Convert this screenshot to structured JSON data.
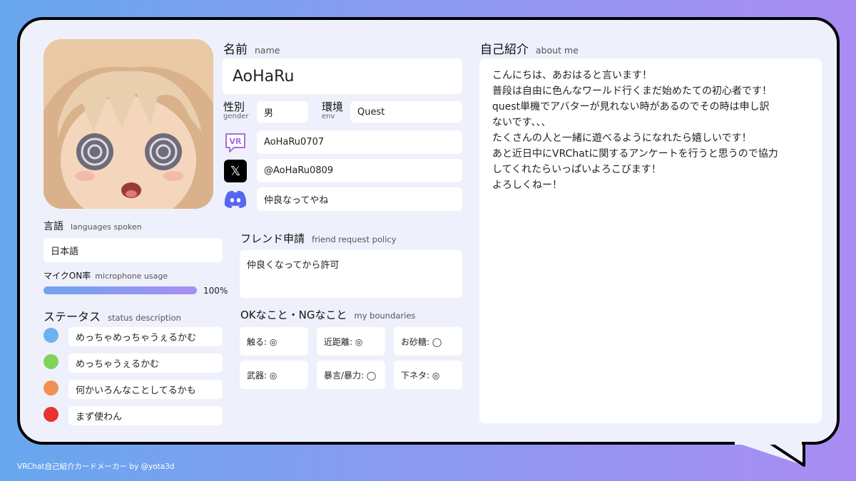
{
  "profile": {
    "name_label": "名前",
    "name_sub": "name",
    "name": "AoHaRu",
    "gender_label": "性別",
    "gender_sub": "gender",
    "gender": "男",
    "env_label": "環境",
    "env_sub": "env",
    "env": "Quest",
    "vrchat_id": "AoHaRu0707",
    "x_handle": "@AoHaRu0809",
    "discord_note": "仲良なってやね"
  },
  "icons": {
    "vrchat": "vrchat-logo-icon",
    "x": "x-logo-icon",
    "discord": "discord-logo-icon",
    "vrchat_text": "VR",
    "x_glyph": "𝕏"
  },
  "languages": {
    "label": "言語",
    "sub": "languages spoken",
    "value": "日本語"
  },
  "microphone": {
    "label": "マイクON率",
    "sub": "microphone usage",
    "percent_text": "100%",
    "fraction": 1.0
  },
  "status": {
    "label": "ステータス",
    "sub": "status description",
    "items": [
      {
        "color": "#6cb2ee",
        "text": "めっちゃめっちゃうぇるかむ"
      },
      {
        "color": "#82d25a",
        "text": "めっちゃうぇるかむ"
      },
      {
        "color": "#ef9152",
        "text": "何かいろんなことしてるかも"
      },
      {
        "color": "#e8332e",
        "text": "まず使わん"
      }
    ]
  },
  "friend": {
    "label": "フレンド申請",
    "sub": "friend request policy",
    "value": "仲良くなってから許可"
  },
  "boundaries": {
    "label": "OKなこと・NGなこと",
    "sub": "my boundaries",
    "items": [
      "触る: ◎",
      "近距離: ◎",
      "お砂糖: ◯",
      "武器: ◎",
      "暴言/暴力: ◯",
      "下ネタ: ◎"
    ]
  },
  "about": {
    "label": "自己紹介",
    "sub": "about me",
    "lines": [
      "こんにちは、あおはると言います！",
      "普段は自由に色んなワールド行くまだ始めたての初心者です！",
      "quest単機でアバターが見れない時があるのでその時は申し訳",
      "ないです、、、",
      "たくさんの人と一緒に遊べるようになれたら嬉しいです！",
      "あと近日中にVRChatに関するアンケートを行うと思うので協力",
      "してくれたらいっぱいよろこびます！",
      "よろしくねー！"
    ]
  },
  "footer": "VRChat自己紹介カードメーカー by @yota3d",
  "colors": {
    "vr_purple": "#a76ee0",
    "discord": "#5865f2"
  }
}
